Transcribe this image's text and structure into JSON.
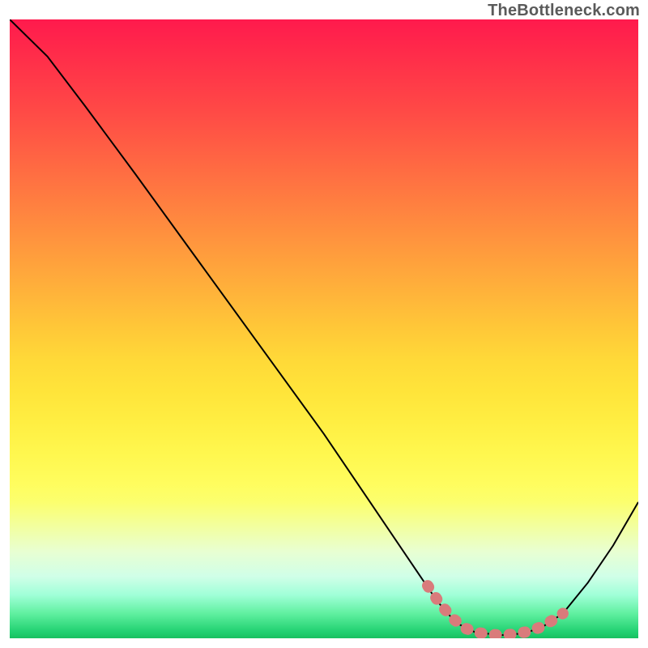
{
  "watermark": "TheBottleneck.com",
  "chart_data": {
    "type": "line",
    "title": "",
    "xlabel": "",
    "ylabel": "",
    "xlim": [
      0,
      100
    ],
    "ylim": [
      0,
      100
    ],
    "series": [
      {
        "name": "curve",
        "color": "#000000",
        "points": [
          {
            "x": 0,
            "y": 100
          },
          {
            "x": 6,
            "y": 94
          },
          {
            "x": 12,
            "y": 86
          },
          {
            "x": 20,
            "y": 75
          },
          {
            "x": 30,
            "y": 61
          },
          {
            "x": 40,
            "y": 47
          },
          {
            "x": 50,
            "y": 33
          },
          {
            "x": 58,
            "y": 21
          },
          {
            "x": 64,
            "y": 12
          },
          {
            "x": 68,
            "y": 6
          },
          {
            "x": 71,
            "y": 2.5
          },
          {
            "x": 74,
            "y": 1
          },
          {
            "x": 78,
            "y": 0.5
          },
          {
            "x": 82,
            "y": 0.8
          },
          {
            "x": 85,
            "y": 2
          },
          {
            "x": 88,
            "y": 4
          },
          {
            "x": 92,
            "y": 9
          },
          {
            "x": 96,
            "y": 15
          },
          {
            "x": 100,
            "y": 22
          }
        ]
      },
      {
        "name": "highlight-band",
        "color": "#d97b7b",
        "points": [
          {
            "x": 66.5,
            "y": 8.5
          },
          {
            "x": 68.5,
            "y": 5.5
          },
          {
            "x": 70.5,
            "y": 3.2
          },
          {
            "x": 72.5,
            "y": 1.6
          },
          {
            "x": 74.5,
            "y": 0.9
          },
          {
            "x": 76.5,
            "y": 0.6
          },
          {
            "x": 78.5,
            "y": 0.5
          },
          {
            "x": 80.5,
            "y": 0.7
          },
          {
            "x": 82.5,
            "y": 1.1
          },
          {
            "x": 84.5,
            "y": 1.8
          },
          {
            "x": 86.5,
            "y": 3.0
          },
          {
            "x": 88.0,
            "y": 4.0
          }
        ]
      }
    ],
    "gradient_note": "Vertical color gradient from red (top, high value) to green (bottom, low value) representing bottleneck severity."
  }
}
